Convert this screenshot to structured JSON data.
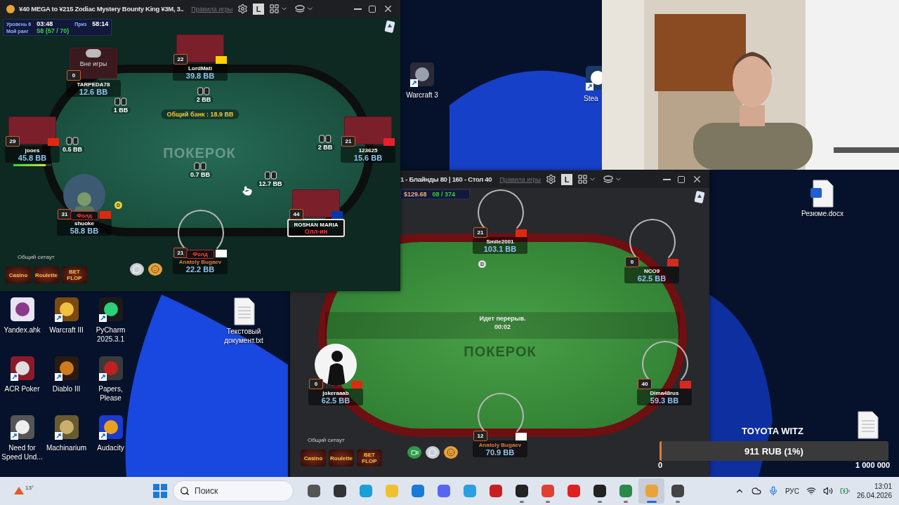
{
  "table_windows": [
    {
      "title": "¥40 MEGA to ¥215 Zodiac Mystery Bounty King ¥3M, 3..",
      "rules_link": "Правила игры",
      "layout_key": "L",
      "hud": {
        "stage": "Уровень 6",
        "time": "03:48",
        "prize_label": "Приз",
        "break_time": "58:14",
        "rank_label": "Мой ранг",
        "rank": "58 (57 / 70)"
      },
      "table": {
        "watermark": "ПОКЕРОК",
        "pot": "Общий банк : 18.9 BB",
        "dealer": "D",
        "bets": [
          "1 BB",
          "2 BB",
          "0.5 BB",
          "2 BB",
          "0.7 BB",
          "12.7 BB"
        ],
        "seats": [
          {
            "name": "TARPEDA78",
            "stack": "12.6 BB",
            "badge": "0",
            "kind": "sitout",
            "away": "Вне игры",
            "hero": false
          },
          {
            "name": "LordMati",
            "stack": "39.8 BB",
            "badge": "22",
            "kind": "cards",
            "color": "#ffd100",
            "hero": false
          },
          {
            "name": "jooes",
            "stack": "45.8 BB",
            "badge": "29",
            "kind": "cards",
            "color": "#de2910",
            "hero": false,
            "timer": {
              "level": 0.85
            }
          },
          {
            "name": "123625",
            "stack": "15.6 BB",
            "badge": "21",
            "kind": "cards",
            "color": "#e8202a",
            "hero": false
          },
          {
            "name": "shuoke",
            "stack": "58.8 BB",
            "badge": "31",
            "kind": "avatar",
            "color": "#de2910",
            "hero": false,
            "status": {
              "kind": "fold",
              "text": "Фолд"
            }
          },
          {
            "name": "ROSHAN MARIA",
            "badge": "44",
            "kind": "cards",
            "color": "#0038a8",
            "hero": false,
            "status": {
              "kind": "allin",
              "text": "Олл-ин"
            }
          },
          {
            "name": "Anatoly Bugaev",
            "stack": "22.2 BB",
            "badge": "21",
            "kind": "empty",
            "color": "#ffffff",
            "hero": true,
            "status": {
              "kind": "fold",
              "text": "Фолд"
            }
          }
        ],
        "sitout_label": "Общий ситаут",
        "games": [
          "Casino",
          "Roulette",
          "BET FLOP"
        ]
      }
    },
    {
      "title": "1 - Блайнды 80 | 160 - Стол 40",
      "rules_link": "Правила игры",
      "layout_key": "L",
      "hud": {
        "prize": "$129.68",
        "rank": "08 / 374"
      },
      "table": {
        "watermark": "ПОКЕРОК",
        "dealer": "D",
        "break_notice": "Идет перерыв.",
        "break_timer": "00:02",
        "seats": [
          {
            "name": "Smile2001",
            "stack": "103.1 BB",
            "badge": "21",
            "kind": "empty",
            "color": "#de2910",
            "hero": false
          },
          {
            "name": "NCO9",
            "stack": "62.5 BB",
            "badge": "0",
            "kind": "empty",
            "color": "#d52b1e",
            "hero": false
          },
          {
            "name": "jokeraaab",
            "stack": "62.5 BB",
            "badge": "0",
            "kind": "silhouette",
            "color": "#de2910",
            "hero": false
          },
          {
            "name": "Dima48rus",
            "stack": "59.3 BB",
            "badge": "40",
            "kind": "empty",
            "color": "#d52b1e",
            "hero": false
          },
          {
            "name": "Anatoly Bugaev",
            "stack": "70.9 BB",
            "badge": "12",
            "kind": "empty",
            "color": "#ffffff",
            "hero": true
          }
        ],
        "sitout_label": "Общий ситаут",
        "games": [
          "Casino",
          "Roulette",
          "BET FLOP"
        ],
        "video_button": true
      }
    }
  ],
  "desktop_grid": [
    {
      "label": "Yandex.ahk",
      "shortcut": false
    },
    {
      "label": "Warcraft III",
      "shortcut": true
    },
    {
      "label": "PyCharm 2025.3.1",
      "shortcut": true
    },
    {
      "label": "ACR Poker",
      "shortcut": true
    },
    {
      "label": "Diablo III",
      "shortcut": true
    },
    {
      "label": "Papers, Please",
      "shortcut": true
    },
    {
      "label": "Need for Speed Und...",
      "shortcut": true
    },
    {
      "label": "Machinarium",
      "shortcut": true
    },
    {
      "label": "Audacity",
      "shortcut": true
    }
  ],
  "desktop_icons": [
    {
      "label": "Текстовый документ.txt"
    },
    {
      "label": "Warcraft 3",
      "shortcut": true
    },
    {
      "label": "Stea",
      "shortcut": true
    },
    {
      "label": "Резюме.docx"
    },
    {
      "kind": "blank"
    }
  ],
  "goal_widget": {
    "title": "TOYOTA WITZ",
    "amount": "911 RUB (1%)",
    "level": 0.01,
    "min": "0",
    "max": "1 000 000"
  },
  "taskbar": {
    "weather": "13°",
    "search_placeholder": "Поиск",
    "apps": [
      {
        "running": false,
        "selected": false
      },
      {
        "running": false,
        "selected": false
      },
      {
        "running": false,
        "selected": false
      },
      {
        "running": false,
        "selected": false
      },
      {
        "running": false,
        "selected": false
      },
      {
        "running": false,
        "selected": false
      },
      {
        "running": false,
        "selected": false
      },
      {
        "running": false,
        "selected": false
      },
      {
        "running": true,
        "selected": false
      },
      {
        "running": true,
        "selected": false
      },
      {
        "running": false,
        "selected": false
      },
      {
        "running": true,
        "selected": false
      },
      {
        "running": true,
        "selected": false
      },
      {
        "running": true,
        "selected": true
      },
      {
        "running": true,
        "selected": false
      }
    ],
    "language": "РУС",
    "time": "13:01",
    "date": "26.04.2026"
  }
}
